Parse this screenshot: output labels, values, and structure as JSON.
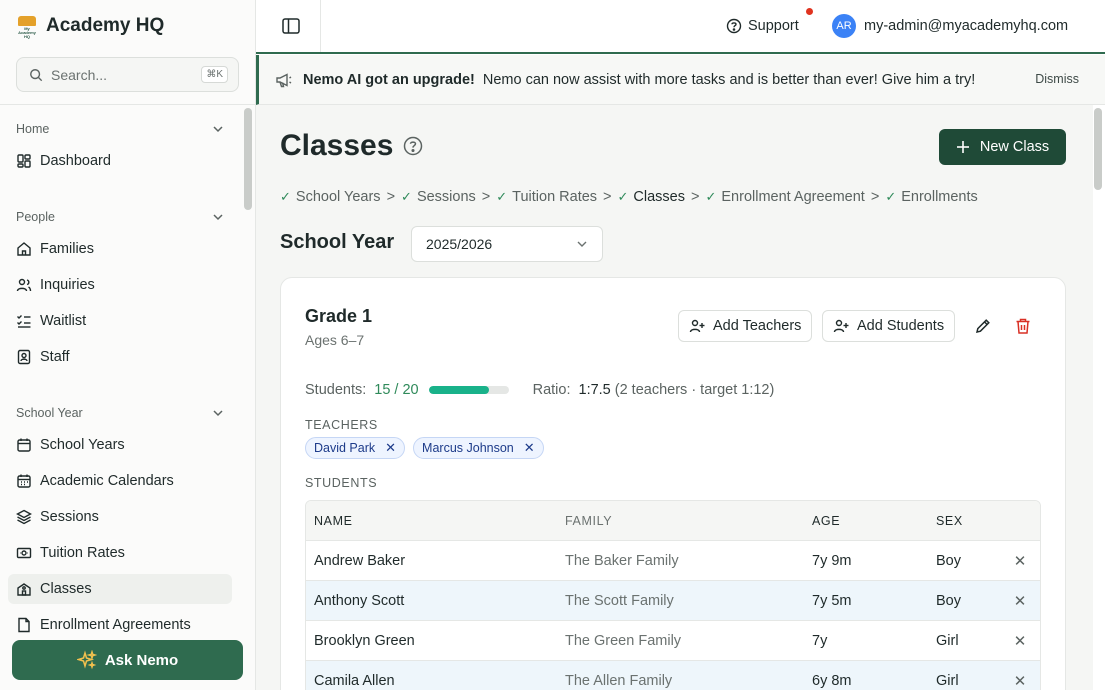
{
  "brand": {
    "name": "Academy HQ",
    "logo_text": "My Academy HQ"
  },
  "search": {
    "placeholder": "Search...",
    "shortcut": "⌘K"
  },
  "sidebar": {
    "sections": [
      {
        "title": "Home",
        "items": [
          {
            "label": "Dashboard",
            "icon": "dashboard-icon"
          }
        ]
      },
      {
        "title": "People",
        "items": [
          {
            "label": "Families",
            "icon": "home-icon"
          },
          {
            "label": "Inquiries",
            "icon": "users-icon"
          },
          {
            "label": "Waitlist",
            "icon": "list-checks-icon"
          },
          {
            "label": "Staff",
            "icon": "id-badge-icon"
          }
        ]
      },
      {
        "title": "School Year",
        "items": [
          {
            "label": "School Years",
            "icon": "calendar-icon"
          },
          {
            "label": "Academic Calendars",
            "icon": "calendar-grid-icon"
          },
          {
            "label": "Sessions",
            "icon": "layers-icon"
          },
          {
            "label": "Tuition Rates",
            "icon": "money-icon"
          },
          {
            "label": "Classes",
            "icon": "school-icon",
            "active": true
          },
          {
            "label": "Enrollment Agreements",
            "icon": "file-icon"
          }
        ]
      }
    ],
    "ask_nemo": "Ask Nemo"
  },
  "topbar": {
    "support": "Support",
    "avatar_initials": "AR",
    "user_email": "my-admin@myacademyhq.com"
  },
  "banner": {
    "title": "Nemo AI got an upgrade!",
    "message": "Nemo can now assist with more tasks and is better than ever! Give him a try!",
    "dismiss": "Dismiss"
  },
  "page": {
    "title": "Classes",
    "new_button": "New Class",
    "steps": [
      "School Years",
      "Sessions",
      "Tuition Rates",
      "Classes",
      "Enrollment Agreement",
      "Enrollments"
    ],
    "current_step": "Classes",
    "school_year_label": "School Year",
    "school_year_value": "2025/2026"
  },
  "class_card": {
    "name": "Grade 1",
    "ages": "Ages 6–7",
    "add_teachers": "Add Teachers",
    "add_students": "Add Students",
    "students_label": "Students:",
    "students_count": "15 / 20",
    "students_fill": 0.75,
    "ratio_label": "Ratio:",
    "ratio_value": "1:7.5",
    "ratio_note": "(2 teachers · target 1:12)",
    "teachers_label": "TEACHERS",
    "teachers": [
      "David Park",
      "Marcus Johnson"
    ],
    "students_section_label": "STUDENTS",
    "columns": [
      "NAME",
      "FAMILY",
      "AGE",
      "SEX"
    ],
    "students": [
      {
        "name": "Andrew Baker",
        "family": "The Baker Family",
        "age": "7y 9m",
        "sex": "Boy"
      },
      {
        "name": "Anthony Scott",
        "family": "The Scott Family",
        "age": "7y 5m",
        "sex": "Boy"
      },
      {
        "name": "Brooklyn Green",
        "family": "The Green Family",
        "age": "7y",
        "sex": "Girl"
      },
      {
        "name": "Camila Allen",
        "family": "The Allen Family",
        "age": "6y 8m",
        "sex": "Girl"
      }
    ]
  },
  "colors": {
    "brand_green": "#2f6b4f",
    "dark_green": "#1f4a37",
    "progress": "#19b28a",
    "danger": "#d93025",
    "chip_blue": "#eef4ff"
  }
}
